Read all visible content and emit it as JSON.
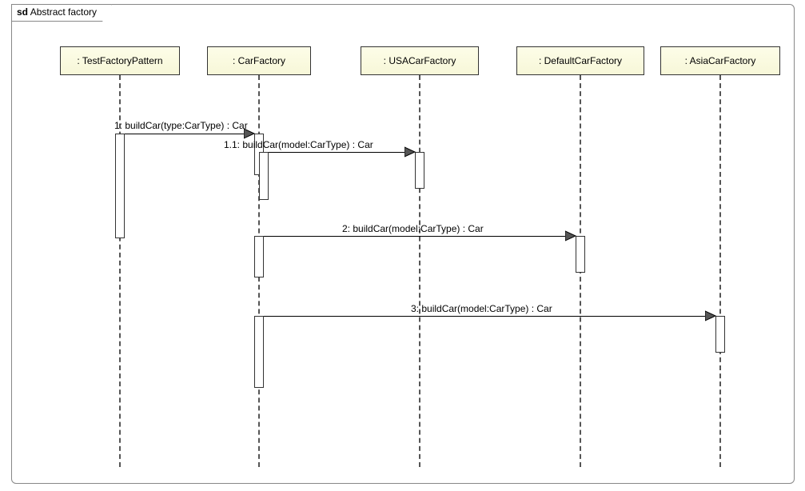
{
  "frame": {
    "prefix": "sd",
    "title": "Abstract factory"
  },
  "participants": {
    "p1": ": TestFactoryPattern",
    "p2": ": CarFactory",
    "p3": ": USACarFactory",
    "p4": ": DefaultCarFactory",
    "p5": ": AsiaCarFactory"
  },
  "messages": {
    "m1": "1: buildCar(type:CarType) : Car",
    "m1_1": "1.1: buildCar(model:CarType) : Car",
    "m2": "2: buildCar(model:CarType) : Car",
    "m3": "3: buildCar(model:CarType) : Car"
  },
  "chart_data": {
    "type": "sequence_diagram",
    "title": "Abstract factory",
    "participants": [
      "TestFactoryPattern",
      "CarFactory",
      "USACarFactory",
      "DefaultCarFactory",
      "AsiaCarFactory"
    ],
    "messages": [
      {
        "seq": "1",
        "from": "TestFactoryPattern",
        "to": "CarFactory",
        "label": "buildCar(type:CarType) : Car"
      },
      {
        "seq": "1.1",
        "from": "CarFactory",
        "to": "USACarFactory",
        "label": "buildCar(model:CarType) : Car"
      },
      {
        "seq": "2",
        "from": "CarFactory",
        "to": "DefaultCarFactory",
        "label": "buildCar(model:CarType) : Car"
      },
      {
        "seq": "3",
        "from": "CarFactory",
        "to": "AsiaCarFactory",
        "label": "buildCar(model:CarType) : Car"
      }
    ]
  }
}
